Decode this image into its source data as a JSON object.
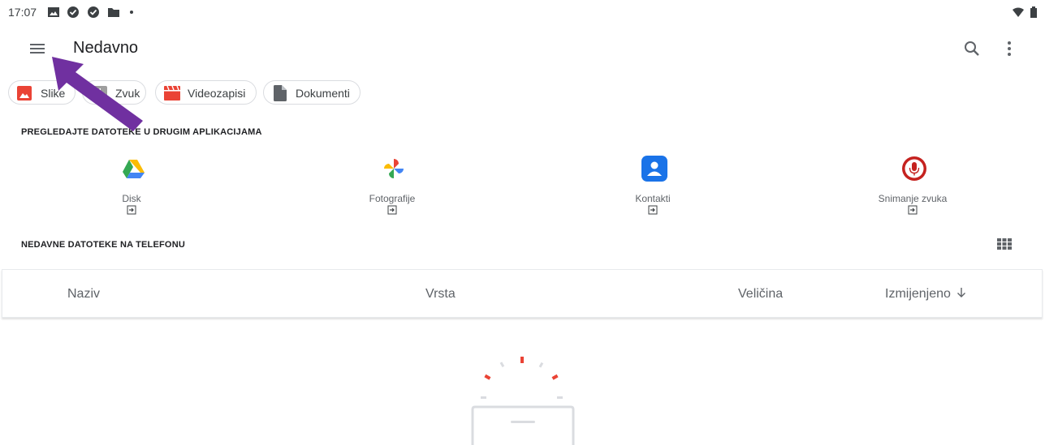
{
  "status_bar": {
    "time": "17:07",
    "icons": [
      "image-icon",
      "check-circle-icon",
      "check-circle-icon",
      "folder-icon",
      "dot-icon",
      "wifi-icon",
      "battery-icon"
    ]
  },
  "top_bar": {
    "title": "Nedavno",
    "icons": [
      "menu-icon",
      "search-icon",
      "more-vert-icon"
    ]
  },
  "filter_chips": [
    {
      "label": "Slike",
      "icon": "image-icon",
      "color": "#ea4335"
    },
    {
      "label": "Zvuk",
      "icon": "audio-icon",
      "color": "#9e9e9e"
    },
    {
      "label": "Videozapisi",
      "icon": "video-icon",
      "color": "#ea4335"
    },
    {
      "label": "Dokumenti",
      "icon": "document-icon",
      "color": "#5f6368"
    }
  ],
  "other_apps": {
    "heading": "PREGLEDAJTE DATOTEKE U DRUGIM APLIKACIJAMA",
    "apps": [
      {
        "name": "Disk",
        "icon": "google-drive-icon"
      },
      {
        "name": "Fotografije",
        "icon": "google-photos-icon"
      },
      {
        "name": "Kontakti",
        "icon": "contacts-icon"
      },
      {
        "name": "Snimanje zvuka",
        "icon": "sound-recorder-icon"
      }
    ]
  },
  "recent": {
    "heading": "NEDAVNE DATOTEKE NA TELEFONU",
    "view_toggle_icon": "grid-view-icon",
    "columns": [
      {
        "label": "Naziv"
      },
      {
        "label": "Vrsta"
      },
      {
        "label": "Veličina"
      },
      {
        "label": "Izmijenjeno",
        "sort": "descending"
      }
    ]
  },
  "annotation": {
    "arrow_color": "#7030a0"
  },
  "colors": {
    "accent_red": "#ea4335",
    "text_primary": "#202124",
    "text_secondary": "#5f6368",
    "divider": "#dadce0"
  }
}
